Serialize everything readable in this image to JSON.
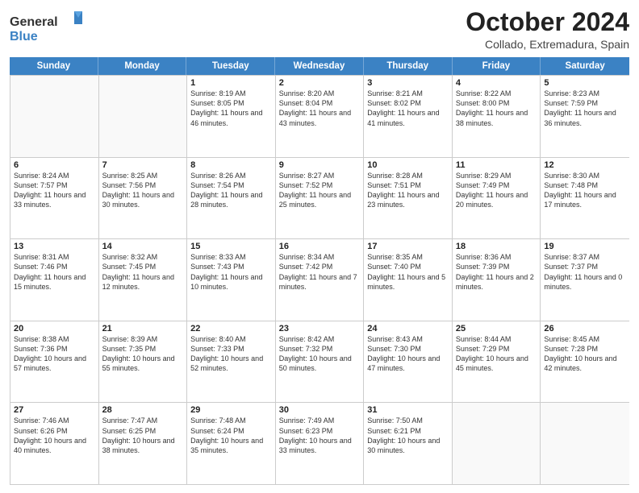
{
  "header": {
    "logo_general": "General",
    "logo_blue": "Blue",
    "month_title": "October 2024",
    "subtitle": "Collado, Extremadura, Spain"
  },
  "days_of_week": [
    "Sunday",
    "Monday",
    "Tuesday",
    "Wednesday",
    "Thursday",
    "Friday",
    "Saturday"
  ],
  "weeks": [
    [
      {
        "day": "",
        "info": ""
      },
      {
        "day": "",
        "info": ""
      },
      {
        "day": "1",
        "info": "Sunrise: 8:19 AM\nSunset: 8:05 PM\nDaylight: 11 hours and 46 minutes."
      },
      {
        "day": "2",
        "info": "Sunrise: 8:20 AM\nSunset: 8:04 PM\nDaylight: 11 hours and 43 minutes."
      },
      {
        "day": "3",
        "info": "Sunrise: 8:21 AM\nSunset: 8:02 PM\nDaylight: 11 hours and 41 minutes."
      },
      {
        "day": "4",
        "info": "Sunrise: 8:22 AM\nSunset: 8:00 PM\nDaylight: 11 hours and 38 minutes."
      },
      {
        "day": "5",
        "info": "Sunrise: 8:23 AM\nSunset: 7:59 PM\nDaylight: 11 hours and 36 minutes."
      }
    ],
    [
      {
        "day": "6",
        "info": "Sunrise: 8:24 AM\nSunset: 7:57 PM\nDaylight: 11 hours and 33 minutes."
      },
      {
        "day": "7",
        "info": "Sunrise: 8:25 AM\nSunset: 7:56 PM\nDaylight: 11 hours and 30 minutes."
      },
      {
        "day": "8",
        "info": "Sunrise: 8:26 AM\nSunset: 7:54 PM\nDaylight: 11 hours and 28 minutes."
      },
      {
        "day": "9",
        "info": "Sunrise: 8:27 AM\nSunset: 7:52 PM\nDaylight: 11 hours and 25 minutes."
      },
      {
        "day": "10",
        "info": "Sunrise: 8:28 AM\nSunset: 7:51 PM\nDaylight: 11 hours and 23 minutes."
      },
      {
        "day": "11",
        "info": "Sunrise: 8:29 AM\nSunset: 7:49 PM\nDaylight: 11 hours and 20 minutes."
      },
      {
        "day": "12",
        "info": "Sunrise: 8:30 AM\nSunset: 7:48 PM\nDaylight: 11 hours and 17 minutes."
      }
    ],
    [
      {
        "day": "13",
        "info": "Sunrise: 8:31 AM\nSunset: 7:46 PM\nDaylight: 11 hours and 15 minutes."
      },
      {
        "day": "14",
        "info": "Sunrise: 8:32 AM\nSunset: 7:45 PM\nDaylight: 11 hours and 12 minutes."
      },
      {
        "day": "15",
        "info": "Sunrise: 8:33 AM\nSunset: 7:43 PM\nDaylight: 11 hours and 10 minutes."
      },
      {
        "day": "16",
        "info": "Sunrise: 8:34 AM\nSunset: 7:42 PM\nDaylight: 11 hours and 7 minutes."
      },
      {
        "day": "17",
        "info": "Sunrise: 8:35 AM\nSunset: 7:40 PM\nDaylight: 11 hours and 5 minutes."
      },
      {
        "day": "18",
        "info": "Sunrise: 8:36 AM\nSunset: 7:39 PM\nDaylight: 11 hours and 2 minutes."
      },
      {
        "day": "19",
        "info": "Sunrise: 8:37 AM\nSunset: 7:37 PM\nDaylight: 11 hours and 0 minutes."
      }
    ],
    [
      {
        "day": "20",
        "info": "Sunrise: 8:38 AM\nSunset: 7:36 PM\nDaylight: 10 hours and 57 minutes."
      },
      {
        "day": "21",
        "info": "Sunrise: 8:39 AM\nSunset: 7:35 PM\nDaylight: 10 hours and 55 minutes."
      },
      {
        "day": "22",
        "info": "Sunrise: 8:40 AM\nSunset: 7:33 PM\nDaylight: 10 hours and 52 minutes."
      },
      {
        "day": "23",
        "info": "Sunrise: 8:42 AM\nSunset: 7:32 PM\nDaylight: 10 hours and 50 minutes."
      },
      {
        "day": "24",
        "info": "Sunrise: 8:43 AM\nSunset: 7:30 PM\nDaylight: 10 hours and 47 minutes."
      },
      {
        "day": "25",
        "info": "Sunrise: 8:44 AM\nSunset: 7:29 PM\nDaylight: 10 hours and 45 minutes."
      },
      {
        "day": "26",
        "info": "Sunrise: 8:45 AM\nSunset: 7:28 PM\nDaylight: 10 hours and 42 minutes."
      }
    ],
    [
      {
        "day": "27",
        "info": "Sunrise: 7:46 AM\nSunset: 6:26 PM\nDaylight: 10 hours and 40 minutes."
      },
      {
        "day": "28",
        "info": "Sunrise: 7:47 AM\nSunset: 6:25 PM\nDaylight: 10 hours and 38 minutes."
      },
      {
        "day": "29",
        "info": "Sunrise: 7:48 AM\nSunset: 6:24 PM\nDaylight: 10 hours and 35 minutes."
      },
      {
        "day": "30",
        "info": "Sunrise: 7:49 AM\nSunset: 6:23 PM\nDaylight: 10 hours and 33 minutes."
      },
      {
        "day": "31",
        "info": "Sunrise: 7:50 AM\nSunset: 6:21 PM\nDaylight: 10 hours and 30 minutes."
      },
      {
        "day": "",
        "info": ""
      },
      {
        "day": "",
        "info": ""
      }
    ]
  ]
}
